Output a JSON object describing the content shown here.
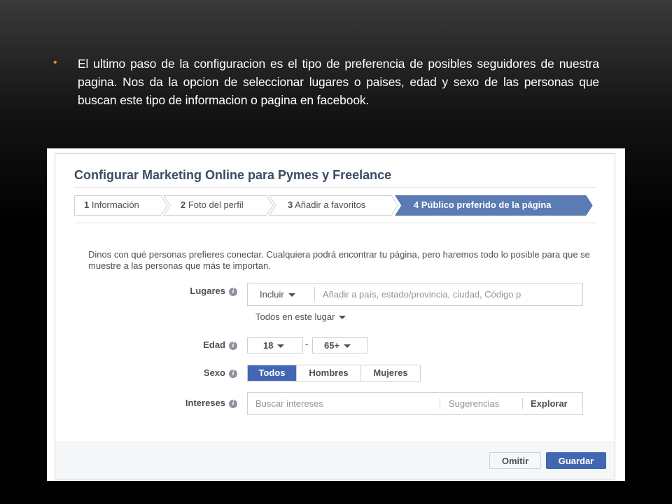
{
  "slide": {
    "bullet": "•",
    "text": "El ultimo paso de la configuracion es el tipo de preferencia de posibles seguidores de nuestra pagina. Nos da la opcion de seleccionar lugares o paises, edad y sexo de las personas que buscan este tipo de informacion o pagina en facebook."
  },
  "dialog": {
    "title": "Configurar Marketing Online para Pymes y Freelance",
    "steps": [
      {
        "num": "1",
        "label": "Información"
      },
      {
        "num": "2",
        "label": "Foto del perfil"
      },
      {
        "num": "3",
        "label": "Añadir a favoritos"
      },
      {
        "num": "4",
        "label": "Público preferido de la página"
      }
    ],
    "intro": "Dinos con qué personas prefieres conectar. Cualquiera podrá encontrar tu página, pero haremos todo lo posible para que se muestre a las personas que más te importan.",
    "lugares": {
      "label": "Lugares",
      "include": "Incluir",
      "placeholder": "Añadir a país, estado/provincia, ciudad, Código p",
      "scope": "Todos en este lugar"
    },
    "edad": {
      "label": "Edad",
      "min": "18",
      "sep": "-",
      "max": "65+"
    },
    "sexo": {
      "label": "Sexo",
      "options": [
        "Todos",
        "Hombres",
        "Mujeres"
      ],
      "selected": "Todos"
    },
    "intereses": {
      "label": "Intereses",
      "placeholder": "Buscar intereses",
      "suggestions": "Sugerencias",
      "explore": "Explorar"
    },
    "footer": {
      "omit": "Omitir",
      "save": "Guardar"
    }
  },
  "colors": {
    "bullet": "#d98b2b",
    "accent": "#4267b2",
    "active_step": "#5b7bb4"
  }
}
